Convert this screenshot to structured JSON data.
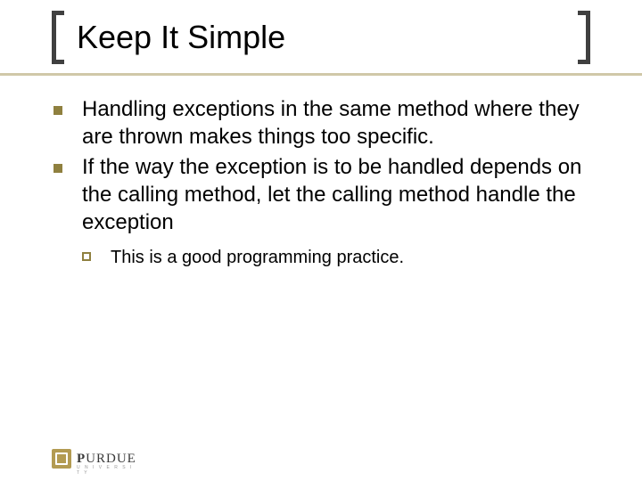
{
  "title": "Keep It Simple",
  "bullets": [
    {
      "text": "Handling exceptions in the same method where they are thrown makes things too specific."
    },
    {
      "text": "If the way the exception is to be handled depends on the calling method, let the calling method handle the exception",
      "sub": [
        {
          "text": "This is a good programming practice."
        }
      ]
    }
  ],
  "logo": {
    "bold": "P",
    "rest": "URDUE",
    "sub": "U N I V E R S I T Y"
  }
}
